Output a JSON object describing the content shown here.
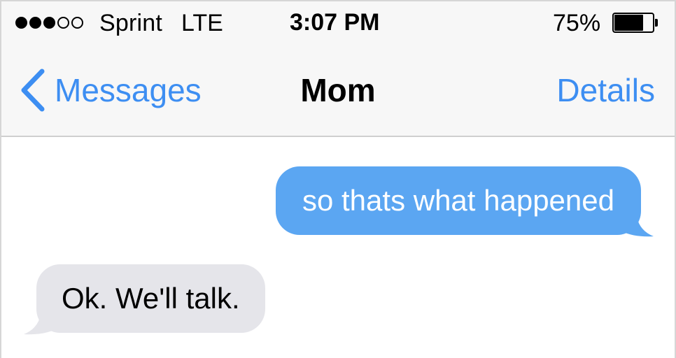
{
  "status_bar": {
    "signal_bars_filled": 3,
    "signal_bars_total": 5,
    "carrier": "Sprint",
    "network": "LTE",
    "time": "3:07 PM",
    "battery_percent": "75%",
    "battery_level": 0.75
  },
  "nav": {
    "back_label": "Messages",
    "back_icon": "chevron-left-icon",
    "title": "Mom",
    "details_label": "Details"
  },
  "messages": [
    {
      "direction": "sent",
      "text": "so thats what happened"
    },
    {
      "direction": "received",
      "text": "Ok. We'll talk."
    }
  ],
  "colors": {
    "accent": "#3d8ef2",
    "sent_bubble": "#5ba6f2",
    "received_bubble": "#e5e5ea",
    "bar_background": "#f7f7f7"
  }
}
